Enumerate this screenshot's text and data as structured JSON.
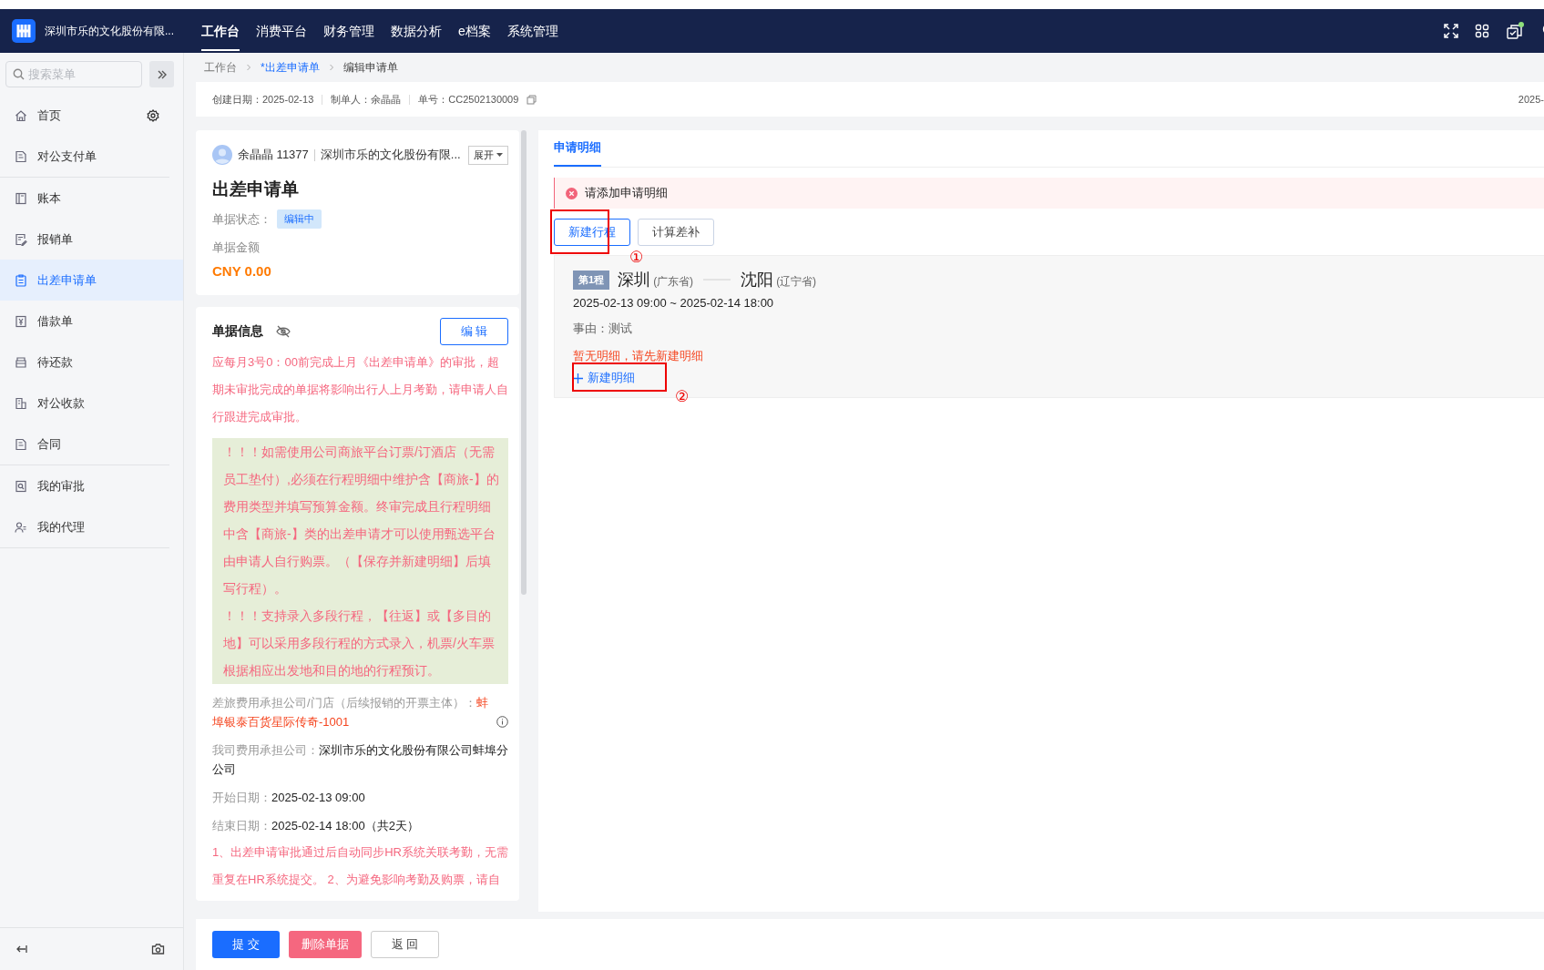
{
  "header": {
    "company": "深圳市乐的文化股份有限...",
    "nav": [
      {
        "label": "工作台",
        "selected": true
      },
      {
        "label": "消费平台",
        "selected": false
      },
      {
        "label": "财务管理",
        "selected": false
      },
      {
        "label": "数据分析",
        "selected": false
      },
      {
        "label": "e档案",
        "selected": false
      },
      {
        "label": "系统管理",
        "selected": false
      }
    ],
    "notification": true
  },
  "sidebar": {
    "search_placeholder": "搜索菜单",
    "groups": [
      {
        "items": [
          {
            "label": "首页",
            "selected": false,
            "settings": true
          },
          {
            "label": "对公支付单",
            "selected": false,
            "settings": false
          }
        ]
      },
      {
        "items": [
          {
            "label": "账本",
            "selected": false,
            "settings": false
          },
          {
            "label": "报销单",
            "selected": false,
            "settings": false
          },
          {
            "label": "出差申请单",
            "selected": true,
            "settings": false
          },
          {
            "label": "借款单",
            "selected": false,
            "settings": false
          },
          {
            "label": "待还款",
            "selected": false,
            "settings": false
          },
          {
            "label": "对公收款",
            "selected": false,
            "settings": false
          },
          {
            "label": "合同",
            "selected": false,
            "settings": false
          }
        ]
      },
      {
        "items": [
          {
            "label": "我的审批",
            "selected": false,
            "settings": false
          },
          {
            "label": "我的代理",
            "selected": false,
            "settings": false
          }
        ]
      }
    ]
  },
  "breadcrumb": [
    {
      "label": "工作台",
      "kind": "plain"
    },
    {
      "label": "*出差申请单",
      "kind": "link"
    },
    {
      "label": "编辑申请单",
      "kind": "current"
    }
  ],
  "info_bar": {
    "fields": [
      {
        "label": "创建日期：",
        "value": "2025-02-13"
      },
      {
        "label": "制单人：",
        "value": "余晶晶"
      },
      {
        "label": "单号：",
        "value": "CC2502130009"
      }
    ],
    "right_text": "2025-"
  },
  "summary_card": {
    "user": "余晶晶 11377",
    "company": "深圳市乐的文化股份有限...",
    "expand_button": "展开",
    "title": "出差申请单",
    "status_label": "单据状态：",
    "status": "编辑中",
    "amount_label": "单据金额",
    "amount": "CNY 0.00"
  },
  "details_card": {
    "title": "单据信息",
    "edit_button": "编 辑",
    "notice": "应每月3号0：00前完成上月《出差申请单》的审批，超期未审批完成的单据将影响出行人上月考勤，请申请人自行跟进完成审批。",
    "highlight": [
      "！！！如需使用公司商旅平台订票/订酒店（无需员工垫付）,必须在行程明细中维护含【商旅-】的费用类型并填写预算金额。终审完成且行程明细中含【商旅-】类的出差申请才可以使用甄选平台由申请人自行购票。（【保存并新建明细】后填写行程）。",
      "！！！支持录入多段行程，【往返】或【多目的地】可以采用多段行程的方式录入，机票/火车票根据相应出发地和目的地的行程预订。"
    ],
    "fields": [
      {
        "label": "差旅费用承担公司/门店（后续报销的开票主体）：",
        "value": "蚌埠银泰百货星际传奇-1001",
        "kind": "warning",
        "info": true
      },
      {
        "label": "我司费用承担公司：",
        "value": "深圳市乐的文化股份有限公司蚌埠分公司",
        "kind": "plain",
        "info": false
      },
      {
        "label": "开始日期：",
        "value": "2025-02-13 09:00",
        "kind": "plain",
        "info": false
      },
      {
        "label": "结束日期：",
        "value": "2025-02-14 18:00（共2天）",
        "kind": "plain",
        "info": false
      }
    ],
    "footer_notice": "1、出差申请审批通过后自动同步HR系统关联考勤，无需重复在HR系统提交。 2、为避免影响考勤及购票，请自"
  },
  "detail_panel": {
    "tabs": [
      {
        "label": "申请明细",
        "selected": true
      }
    ],
    "alert": "请添加申请明细",
    "actions": [
      {
        "label": "新建行程",
        "kind": "primary"
      },
      {
        "label": "计算差补",
        "kind": "default"
      }
    ],
    "trip": {
      "badge": "第1程",
      "from": "深圳",
      "from_province": "(广东省)",
      "to": "沈阳",
      "to_province": "(辽宁省)",
      "time": "2025-02-13 09:00 ~ 2025-02-14 18:00",
      "reason": "事由：测试",
      "empty": "暂无明细，请先新建明细",
      "add_button": "新建明细"
    },
    "annotations": [
      {
        "label": "①"
      },
      {
        "label": "②"
      }
    ]
  },
  "footer_buttons": [
    {
      "label": "提 交",
      "kind": "primary"
    },
    {
      "label": "删除单据",
      "kind": "danger"
    },
    {
      "label": "返 回",
      "kind": "default"
    }
  ]
}
